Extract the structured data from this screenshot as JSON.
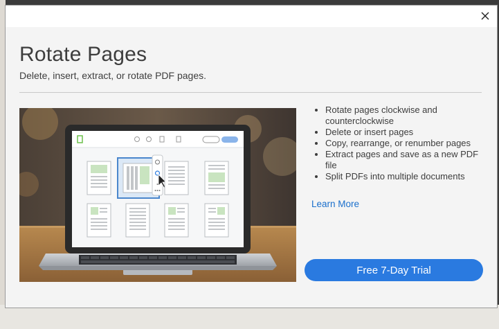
{
  "window": {
    "close_icon": "close-icon"
  },
  "header": {
    "title": "Rotate Pages",
    "subtitle": "Delete, insert, extract, or rotate PDF pages."
  },
  "hero": {
    "icon": "laptop-illustration"
  },
  "features": [
    "Rotate pages clockwise and counterclockwise",
    "Delete or insert pages",
    "Copy, rearrange, or renumber pages",
    "Extract pages and save as a new PDF file",
    "Split PDFs into multiple documents"
  ],
  "learn_more": "Learn More",
  "cta": {
    "label": "Free 7-Day Trial",
    "color": "#2a7ae0"
  }
}
